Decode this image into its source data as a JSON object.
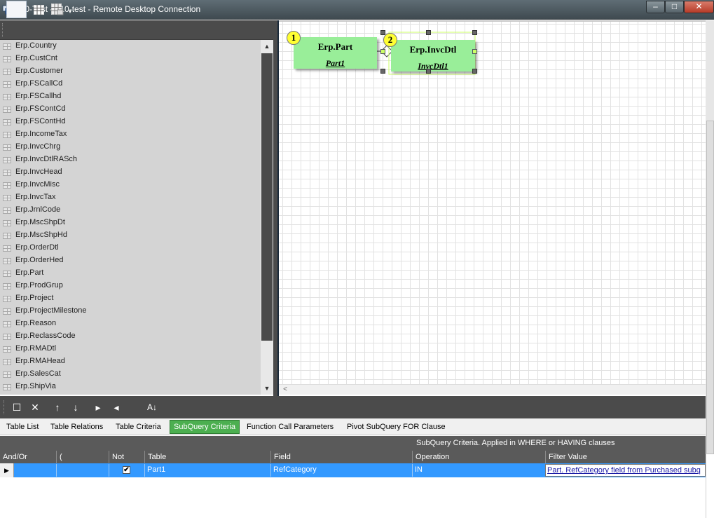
{
  "window": {
    "title": "e10-Test - e10-test - Remote Desktop Connection",
    "controls": {
      "minimize": "–",
      "maximize": "□",
      "close": "✕"
    }
  },
  "left_toolbar": {
    "icons": [
      "blank-view-icon",
      "grid-icon",
      "calculator-icon",
      "dropdown-arrow-icon"
    ],
    "dropdown_glyph": "▾"
  },
  "table_list": {
    "items": [
      "Erp.Country",
      "Erp.CustCnt",
      "Erp.Customer",
      "Erp.FSCallCd",
      "Erp.FSCallhd",
      "Erp.FSContCd",
      "Erp.FSContHd",
      "Erp.IncomeTax",
      "Erp.InvcChrg",
      "Erp.InvcDtlRASch",
      "Erp.InvcHead",
      "Erp.InvcMisc",
      "Erp.InvcTax",
      "Erp.JrnlCode",
      "Erp.MscShpDt",
      "Erp.MscShpHd",
      "Erp.OrderDtl",
      "Erp.OrderHed",
      "Erp.Part",
      "Erp.ProdGrup",
      "Erp.Project",
      "Erp.ProjectMilestone",
      "Erp.Reason",
      "Erp.ReclassCode",
      "Erp.RMADtl",
      "Erp.RMAHead",
      "Erp.SalesCat",
      "Erp.ShipVia"
    ],
    "scroll_up": "▲",
    "scroll_down": "▼"
  },
  "canvas": {
    "nodes": [
      {
        "number": "1",
        "table": "Erp.Part",
        "alias": "Part1"
      },
      {
        "number": "2",
        "table": "Erp.InvcDtl",
        "alias": "InvcDtl1"
      }
    ],
    "hscroll_left": "<"
  },
  "bottom_toolbar": {
    "icons": [
      "new-icon",
      "delete-icon",
      "move-up-icon",
      "move-down-icon",
      "play-icon",
      "back-icon",
      "sort-az-icon"
    ],
    "glyphs": {
      "new": "☐",
      "delete": "✕",
      "up": "↑",
      "down": "↓",
      "play": "▸",
      "back": "◂",
      "sort": "A↓"
    }
  },
  "tabs": [
    {
      "label": "Table List",
      "active": false
    },
    {
      "label": "Table Relations",
      "active": false
    },
    {
      "label": "Table Criteria",
      "active": false
    },
    {
      "label": "SubQuery Criteria",
      "active": true
    },
    {
      "label": "Function Call Parameters",
      "active": false
    },
    {
      "label": "Pivot SubQuery FOR Clause",
      "active": false
    }
  ],
  "colors": {
    "active_tab": "#4caf50",
    "selected_row": "#3399ff",
    "node_fill": "#99ee99",
    "badge": "#ffff33"
  },
  "criteria_grid": {
    "caption": "SubQuery Criteria. Applied in WHERE or HAVING clauses",
    "columns": [
      "And/Or",
      "(",
      "Not",
      "Table",
      "Field",
      "Operation",
      "Filter Value"
    ],
    "rows": [
      {
        "and_or": "",
        "paren": "",
        "not": "✔",
        "table": "Part1",
        "field": "RefCategory",
        "operation": "IN",
        "filter_value": "Part. RefCategory field from Purchased subq"
      }
    ],
    "row_indicator": "▶"
  }
}
